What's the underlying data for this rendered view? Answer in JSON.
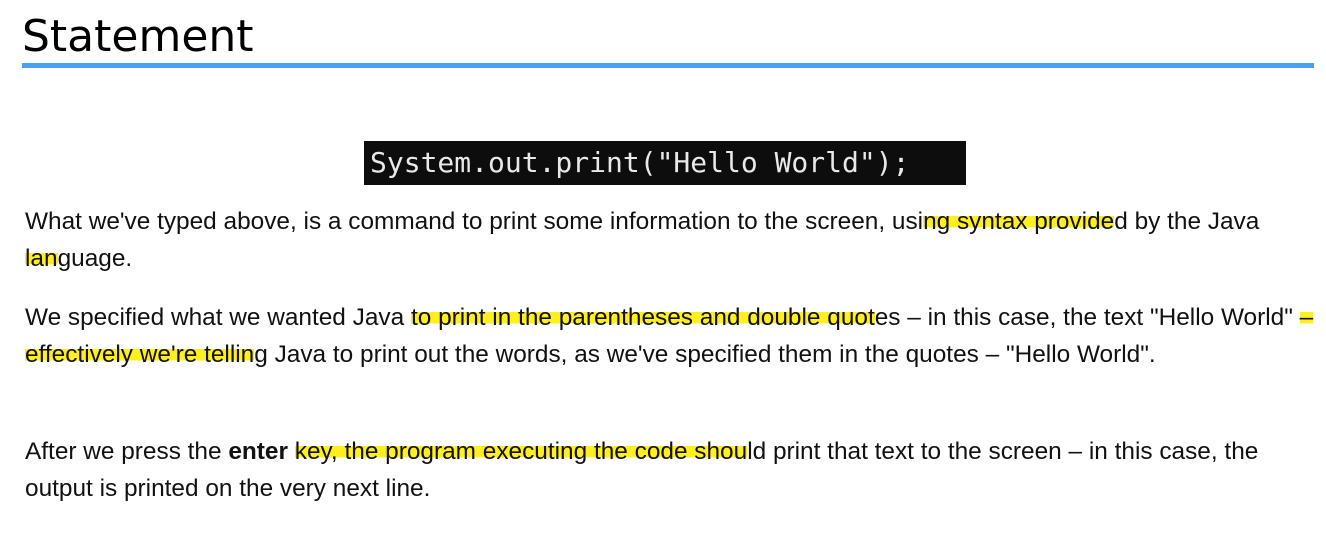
{
  "heading": {
    "title": "Statement"
  },
  "code": {
    "line": "System.out.print(\"Hello World\");"
  },
  "colors": {
    "heading_rule": "#4aa0f0",
    "code_background": "#0d0d0d",
    "code_text": "#e9e9e9",
    "highlighter": "#ffef1f"
  },
  "paragraphs": [
    {
      "segments": [
        {
          "text": "What we've typed above, is a command to print some information to the screen, usi"
        },
        {
          "text": "ng syntax provide",
          "highlight": true
        },
        {
          "text": "d by the Java "
        },
        {
          "text": "lan",
          "highlight": true
        },
        {
          "text": "guage."
        }
      ]
    },
    {
      "segments": [
        {
          "text": "We specified what we wanted Java "
        },
        {
          "text": "to print in the parentheses and double quot",
          "highlight": true
        },
        {
          "text": "es – in this case, the text \"Hello World\" "
        },
        {
          "text": "– effectively we're tellin",
          "highlight": true
        },
        {
          "text": "g Java to print out the words, as we've specified them in the quotes – \"Hello World\"."
        }
      ]
    },
    {
      "segments": [
        {
          "text": "After we press the "
        },
        {
          "text": "enter",
          "bold": true
        },
        {
          "text": " "
        },
        {
          "text": "key, the program executing the code shou",
          "highlight": true
        },
        {
          "text": "ld print that text to the screen – in this case, the output is printed on the very next line."
        }
      ]
    }
  ]
}
